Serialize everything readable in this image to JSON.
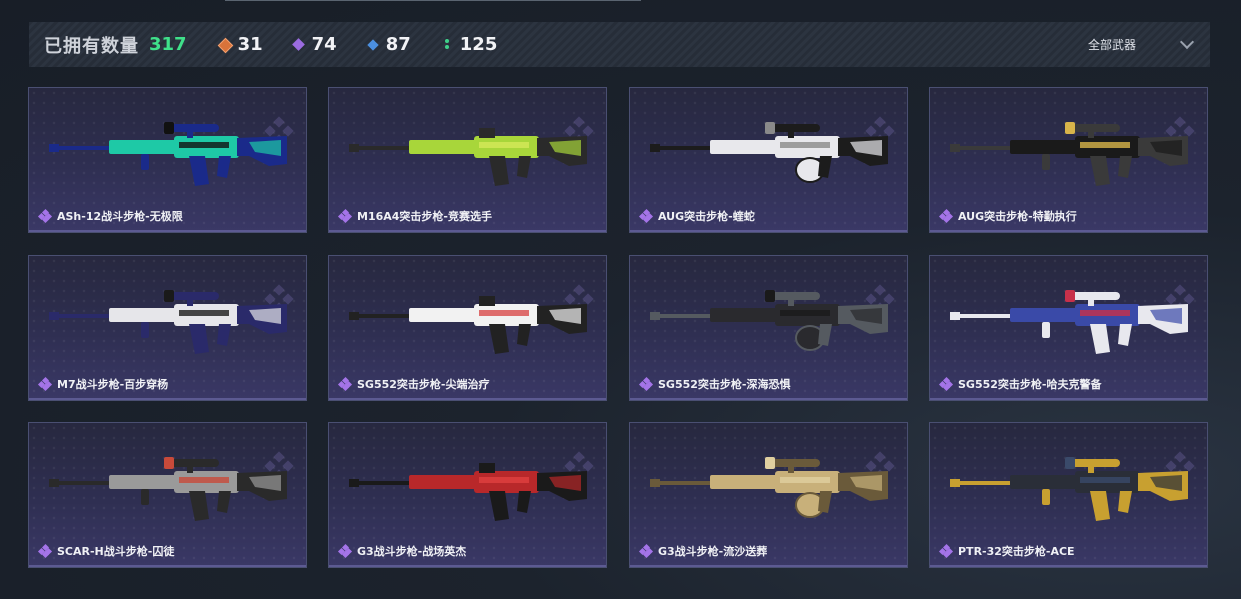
{
  "header": {
    "owned_label": "已拥有数量",
    "owned_total": "317",
    "stats": [
      {
        "icon": "orange-gem-icon",
        "value": "31"
      },
      {
        "icon": "purple-gem-icon",
        "value": "74"
      },
      {
        "icon": "blue-gem-icon",
        "value": "87"
      },
      {
        "icon": "green-dots-icon",
        "value": "125"
      }
    ],
    "filter_label": "全部武器"
  },
  "weapons": [
    {
      "name": "ASh-12战斗步枪-无极限",
      "colors": [
        "#1ec9a6",
        "#1a2a8a",
        "#111111"
      ]
    },
    {
      "name": "M16A4突击步枪-竞赛选手",
      "colors": [
        "#a8d63a",
        "#2a2a2a",
        "#d4e85a"
      ]
    },
    {
      "name": "AUG突击步枪-蝰蛇",
      "colors": [
        "#e8e8ec",
        "#1c1c1c",
        "#8a8a8a"
      ]
    },
    {
      "name": "AUG突击步枪-特勤执行",
      "colors": [
        "#1a1a1a",
        "#3a3a3a",
        "#d8b44a"
      ]
    },
    {
      "name": "M7战斗步枪-百步穿杨",
      "colors": [
        "#e6e6ea",
        "#2a2a6a",
        "#1a1a1a"
      ]
    },
    {
      "name": "SG552突击步枪-尖端治疗",
      "colors": [
        "#f2f2f2",
        "#222222",
        "#d84a4a"
      ]
    },
    {
      "name": "SG552突击步枪-深海恐惧",
      "colors": [
        "#2a2a2e",
        "#555a60",
        "#1a1a1a"
      ]
    },
    {
      "name": "SG552突击步枪-哈夫克警备",
      "colors": [
        "#3a4aa8",
        "#e8e8ee",
        "#c8304a"
      ]
    },
    {
      "name": "SCAR-H战斗步枪-囚徒",
      "colors": [
        "#9a9a9a",
        "#2a2a2a",
        "#c84a3a"
      ]
    },
    {
      "name": "G3战斗步枪-战场英杰",
      "colors": [
        "#b8282a",
        "#1a1a1a",
        "#e04040"
      ]
    },
    {
      "name": "G3战斗步枪-流沙送葬",
      "colors": [
        "#c8b07a",
        "#6a5a3a",
        "#e0d0a0"
      ]
    },
    {
      "name": "PTR-32突击步枪-ACE",
      "colors": [
        "#2a2e38",
        "#c8a030",
        "#3a4a6a"
      ]
    }
  ]
}
